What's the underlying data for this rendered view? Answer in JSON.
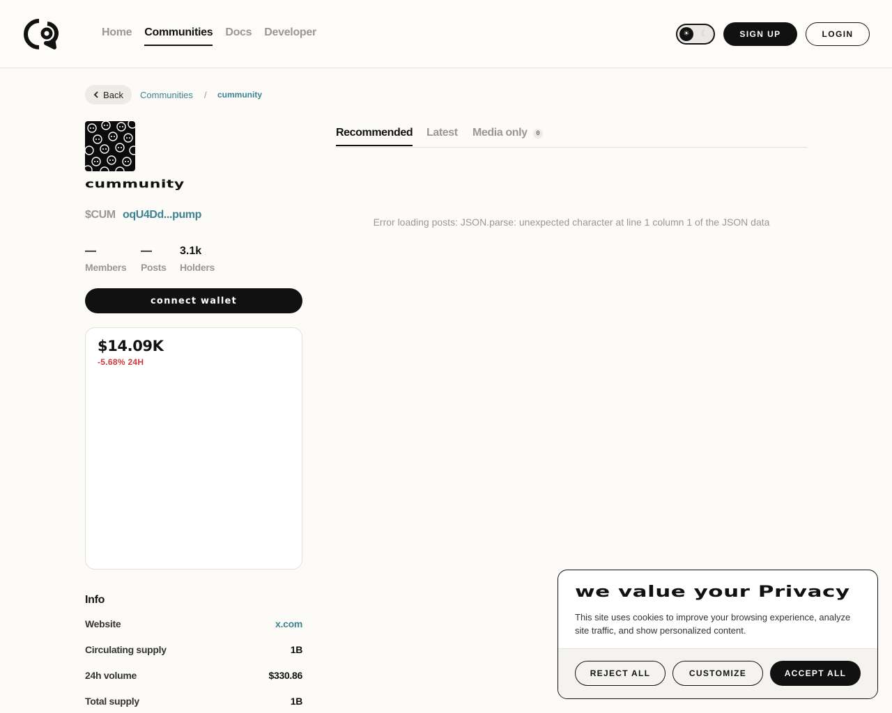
{
  "header": {
    "nav": [
      "Home",
      "Communities",
      "Docs",
      "Developer"
    ],
    "active_nav": "Communities",
    "theme_sun": "☀",
    "theme_moon": "☾",
    "signup_label": "SIGN UP",
    "login_label": "LOGIN"
  },
  "breadcrumb": {
    "back_label": "Back",
    "communities": "Communities",
    "separator": "/",
    "current": "cummunity"
  },
  "community": {
    "name": "cummunity",
    "ticker": "$CUM",
    "address": "oqU4Dd...pump",
    "stats": [
      {
        "value": "—",
        "label": "Members"
      },
      {
        "value": "—",
        "label": "Posts"
      },
      {
        "value": "3.1k",
        "label": "Holders"
      }
    ],
    "connect_label": "connect wallet"
  },
  "market": {
    "price": "$14.09K",
    "change": "-5.68% 24H"
  },
  "info": {
    "title": "Info",
    "rows": [
      {
        "key": "Website",
        "value": "x.com"
      },
      {
        "key": "Circulating supply",
        "value": "1B"
      },
      {
        "key": "24h volume",
        "value": "$330.86"
      },
      {
        "key": "Total supply",
        "value": "1B"
      }
    ]
  },
  "feed": {
    "tabs": [
      "Recommended",
      "Latest",
      "Media only"
    ],
    "media_count": "0",
    "error": "Error loading posts: JSON.parse: unexpected character at line 1 column 1 of the JSON data"
  },
  "cookie": {
    "title": "we value your Privacy",
    "text": "This site uses cookies to improve your browsing experience, analyze site traffic, and show personalized content.",
    "reject_label": "REJECT ALL",
    "customize_label": "CUSTOMIZE",
    "accept_label": "ACCEPT ALL"
  },
  "colors": {
    "accent": "#3d8391",
    "negative": "#cf3a3a",
    "dark": "#111111",
    "background": "#fcfbf7"
  }
}
